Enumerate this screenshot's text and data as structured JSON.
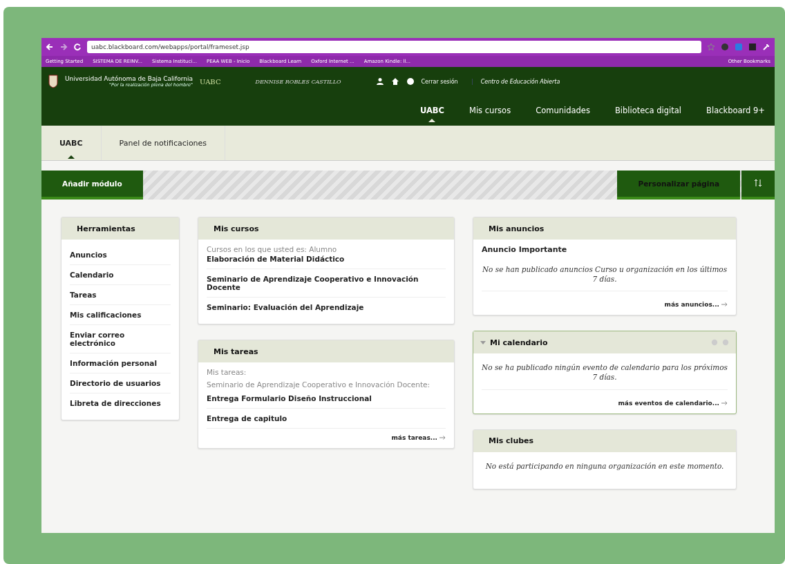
{
  "browser": {
    "url": "uabc.blackboard.com/webapps/portal/frameset.jsp",
    "bookmarks": [
      "Getting Started",
      "SISTEMA DE REINV...",
      "Sistema Instituci...",
      "PEAA WEB - Inicio",
      "Blackboard Learn",
      "Oxford Internet ...",
      "Amazon Kindle: ll...",
      "Other Bookmarks"
    ]
  },
  "header": {
    "university": "Universidad Autónoma de Baja California",
    "motto": "\"Por la realización plena del hombre\"",
    "logo_text": "UABC",
    "user": "DENNISE ROBLES CASTILLO",
    "logout": "Cerrar sesión",
    "institution": "Centro de Educación Abierta"
  },
  "nav_tabs": [
    {
      "label": "UABC",
      "selected": true
    },
    {
      "label": "Mis cursos",
      "selected": false
    },
    {
      "label": "Comunidades",
      "selected": false
    },
    {
      "label": "Biblioteca digital",
      "selected": false
    },
    {
      "label": "Blackboard 9+",
      "selected": false
    }
  ],
  "sub_tabs": [
    {
      "label": "UABC",
      "selected": true
    },
    {
      "label": "Panel de notificaciones",
      "selected": false
    }
  ],
  "toolbar": {
    "add_module": "Añadir módulo",
    "personalize": "Personalizar página"
  },
  "tools": {
    "title": "Herramientas",
    "items": [
      "Anuncios",
      "Calendario",
      "Tareas",
      "Mis calificaciones",
      "Enviar correo electrónico",
      "Información personal",
      "Directorio de usuarios",
      "Libreta de direcciones"
    ]
  },
  "courses": {
    "title": "Mis cursos",
    "caption": "Cursos en los que usted es: Alumno",
    "items": [
      "Elaboración de Material Didáctico",
      "Seminario de Aprendizaje Cooperativo e Innovación Docente",
      "Seminario: Evaluación del Aprendizaje"
    ]
  },
  "tasks": {
    "title": "Mis tareas",
    "caption": "Mis tareas:",
    "course": "Seminario de Aprendizaje Cooperativo e Innovación Docente:",
    "items": [
      "Entrega Formulario Diseño Instruccional",
      "Entrega de capitulo"
    ],
    "more": "más tareas..."
  },
  "announcements": {
    "title": "Mis anuncios",
    "heading": "Anuncio Importante",
    "message": "No se han publicado anuncios Curso u organización en los últimos 7 días.",
    "more": "más anuncios..."
  },
  "calendar": {
    "title": "Mi calendario",
    "expanded": true,
    "message": "No se ha publicado ningún evento de calendario para los próximos 7 días.",
    "more": "más eventos de calendario..."
  },
  "clubs": {
    "title": "Mis clubes",
    "message": "No está participando en ninguna organización en este momento."
  }
}
